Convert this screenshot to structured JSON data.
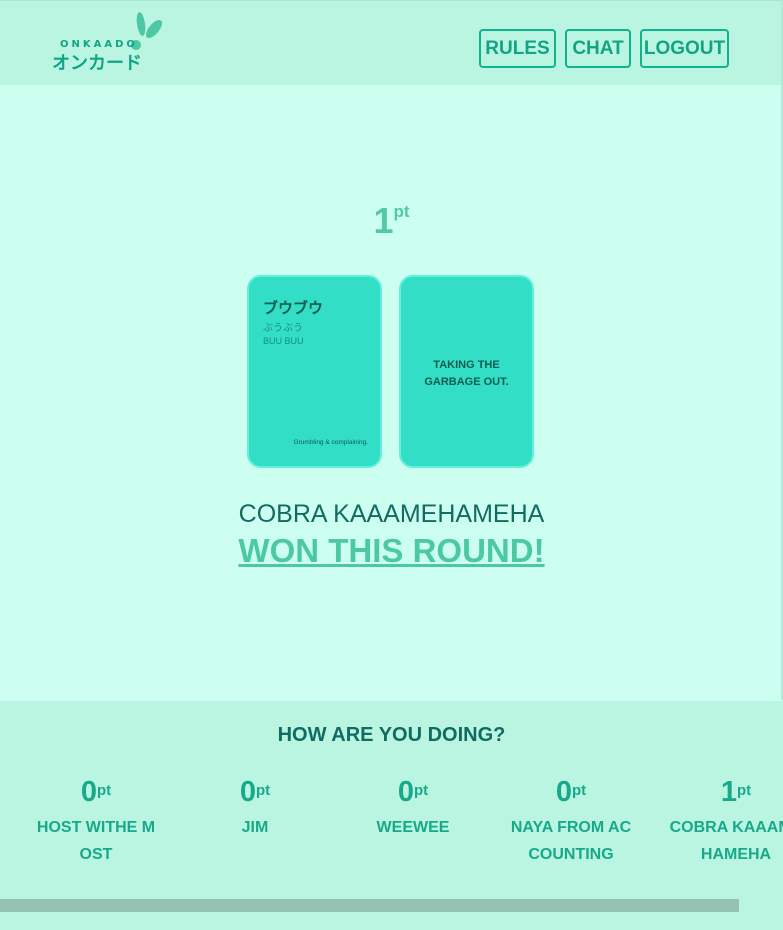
{
  "header": {
    "logo_latin": "ONKAADO",
    "logo_jp": "オンカード",
    "nav": [
      "RULES",
      "CHAT",
      "LOGOUT"
    ]
  },
  "round": {
    "points": "1",
    "points_unit": "pt"
  },
  "cards": {
    "word": {
      "japanese": "ブウブウ",
      "kana": "ぶうぶう",
      "romaji": "BUU BUU",
      "meaning": "Grumbling & complaining."
    },
    "prompt": "TAKING THE GARBAGE OUT."
  },
  "winner": {
    "name": "COBRA KAAAMEHAMEHA",
    "message": "WON THIS ROUND!"
  },
  "scoreboard": {
    "title": "HOW ARE YOU DOING?",
    "unit": "pt",
    "players": [
      {
        "points": "0",
        "name": "HOST WITHE MOST"
      },
      {
        "points": "0",
        "name": "JIM"
      },
      {
        "points": "0",
        "name": "WEEWEE"
      },
      {
        "points": "0",
        "name": "NAYA FROM ACCOUNTING"
      },
      {
        "points": "1",
        "name": "COBRA KAAAMEHAMEHA"
      }
    ]
  },
  "colors": {
    "background": "#cdfff0",
    "header": "#baf5e1",
    "accent": "#11b38f",
    "card": "#32dec6",
    "text_dark": "#116b62"
  }
}
